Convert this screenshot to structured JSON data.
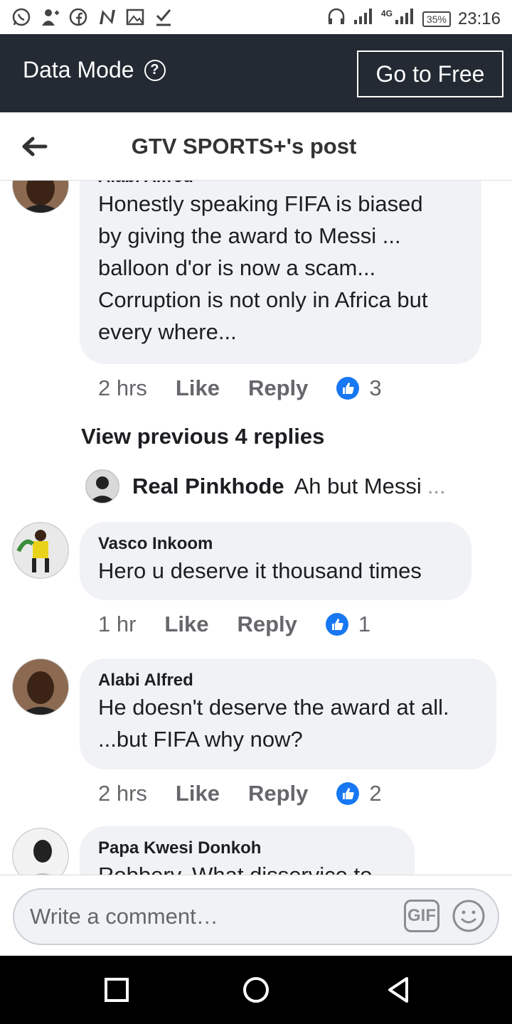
{
  "status_bar": {
    "left_icons": [
      "whatsapp-icon",
      "add-contact-icon",
      "facebook-icon",
      "n-app-icon",
      "image-icon",
      "download-check-icon"
    ],
    "network": "4G",
    "battery": "35%",
    "time": "23:16"
  },
  "data_mode": {
    "title": "Data Mode",
    "help": "?",
    "go_free_label": "Go to Free"
  },
  "header": {
    "title": "GTV SPORTS+'s post"
  },
  "comments": [
    {
      "name": "Alabi Alfred",
      "text": "Honestly speaking FIFA is biased by giving the award to Messi ... balloon d'or  is now a scam... Corruption is not only in Africa but every where...",
      "lines": [
        "Honestly speaking FIFA is biased",
        "by giving the award to Messi ...",
        "balloon d'or  is now a scam...",
        "Corruption is not only in Africa but",
        "every where..."
      ],
      "time": "2 hrs",
      "like": "Like",
      "reply": "Reply",
      "reactions": "3"
    },
    {
      "name": "Vasco Inkoom",
      "lines": [
        "Hero u deserve it thousand times"
      ],
      "time": "1 hr",
      "like": "Like",
      "reply": "Reply",
      "reactions": "1"
    },
    {
      "name": "Alabi Alfred",
      "lines": [
        "He doesn't deserve the award at all.",
        "...but FIFA why now?"
      ],
      "time": "2 hrs",
      "like": "Like",
      "reply": "Reply",
      "reactions": "2"
    },
    {
      "name": "Papa Kwesi Donkoh",
      "lines": [
        "Robbery. What disservice to"
      ]
    }
  ],
  "view_previous": "View previous 4 replies",
  "reply_preview": {
    "name": "Real Pinkhode",
    "text": "Ah but Messi",
    "ellipsis": "..."
  },
  "composer": {
    "placeholder": "Write a comment…",
    "gif": "GIF"
  },
  "colors": {
    "data_mode_bg": "#242a33",
    "like_blue": "#1877f2",
    "bubble_bg": "#f0f2f5"
  }
}
